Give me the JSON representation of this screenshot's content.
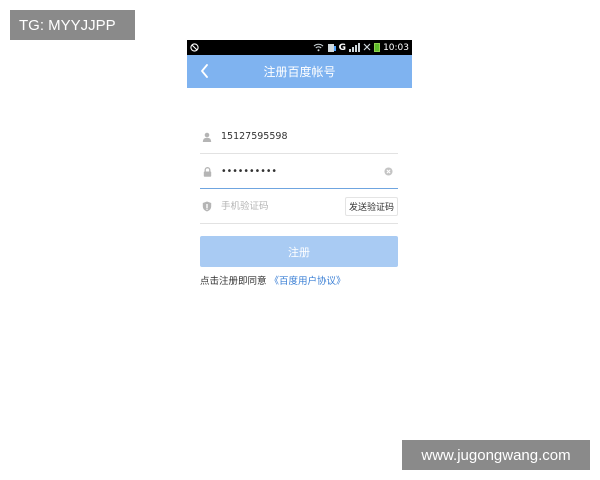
{
  "overlay": {
    "tg_label": "TG: MYYJJPP",
    "site_label": "www.jugongwang.com"
  },
  "status_bar": {
    "time": "10:03",
    "network": "G"
  },
  "header": {
    "title": "注册百度帐号",
    "back_icon": "chevron-left-icon"
  },
  "form": {
    "phone_value": "15127595598",
    "password_value": "••••••••••",
    "code_placeholder": "手机验证码",
    "send_code_label": "发送验证码"
  },
  "register_button": {
    "label": "注册"
  },
  "agreement": {
    "prefix": "点击注册即同意",
    "link": "《百度用户协议》"
  },
  "colors": {
    "header_bg": "#7fb3f0",
    "button_bg": "#a9cbf3",
    "link": "#3a7fd5"
  }
}
